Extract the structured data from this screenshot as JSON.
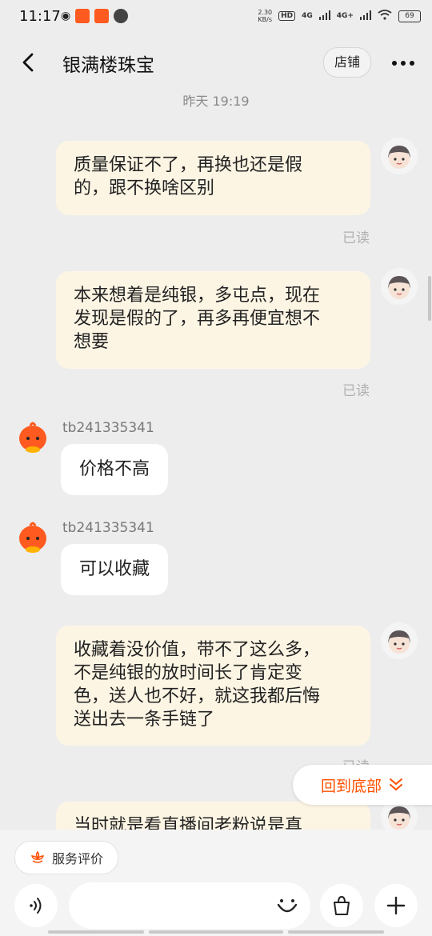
{
  "status_bar": {
    "time": "11:17",
    "net_speed_value": "2.30",
    "net_speed_unit": "KB/s",
    "hd_badge": "HD",
    "network1": "4G",
    "network2": "4G+",
    "battery": "69"
  },
  "header": {
    "title": "银满楼珠宝",
    "shop_button": "店铺"
  },
  "timestamp": "昨天  19:19",
  "messages": [
    {
      "text_lines": [
        "质量保证不了，再换也还是假",
        "的，跟不换啥区别"
      ],
      "read": "已读"
    },
    {
      "text_lines": [
        "本来想着是纯银，多屯点，现在",
        "发现是假的了，再多再便宜想不",
        "想要"
      ],
      "read": "已读"
    },
    {
      "sender": "tb241335341",
      "text": "价格不高"
    },
    {
      "sender": "tb241335341",
      "text": "可以收藏"
    },
    {
      "text_lines": [
        "收藏着没价值，带不了这么多，",
        "不是纯银的放时间长了肯定变",
        "色，送人也不好，就这我都后悔",
        "送出去一条手链了"
      ],
      "read": "已读"
    },
    {
      "text_lines": [
        "当时就是看直播间老粉说是真"
      ]
    }
  ],
  "back_to_bottom": "回到底部",
  "bottom_bar": {
    "service_chip": "服务评价",
    "input_value": ""
  },
  "colors": {
    "accent": "#ff5000",
    "own_bubble": "#fdf5e4",
    "background": "#ededed"
  }
}
